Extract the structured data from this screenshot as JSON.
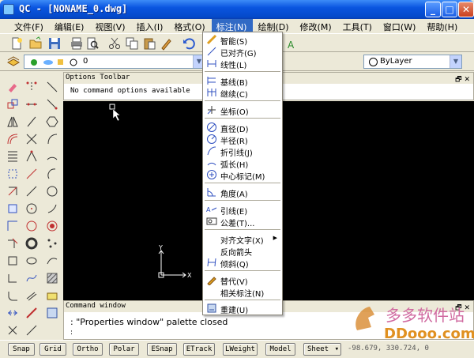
{
  "window": {
    "title": "QC - [NONAME_0.dwg]"
  },
  "menubar": {
    "items": [
      {
        "label": "文件(F)"
      },
      {
        "label": "编辑(E)"
      },
      {
        "label": "视图(V)"
      },
      {
        "label": "插入(I)"
      },
      {
        "label": "格式(O)"
      },
      {
        "label": "标注(N)"
      },
      {
        "label": "绘制(D)"
      },
      {
        "label": "修改(M)"
      },
      {
        "label": "工具(T)"
      },
      {
        "label": "窗口(W)"
      },
      {
        "label": "帮助(H)"
      }
    ]
  },
  "layer_toolbar": {
    "layer_value": "0",
    "color_value": "ByLayer"
  },
  "options_toolbar": {
    "title": "Options Toolbar",
    "message": "No command options available"
  },
  "command_window": {
    "title": "Command window",
    "last_line": ": \"Properties window\" palette closed",
    "prompt": ":"
  },
  "statusbar": {
    "buttons": [
      "Snap",
      "Grid",
      "Ortho",
      "Polar",
      "ESnap",
      "ETrack",
      "LWeight",
      "Model"
    ],
    "sheet": "Sheet",
    "coords": "-98.679, 330.724, 0"
  },
  "dimension_menu": {
    "items": [
      {
        "label": "智能(S)",
        "icon": "smart-dim-icon"
      },
      {
        "label": "已对齐(G)",
        "icon": "aligned-dim-icon"
      },
      {
        "label": "线性(L)",
        "icon": "linear-dim-icon"
      },
      {
        "label": "基线(B)",
        "icon": "baseline-dim-icon"
      },
      {
        "label": "继续(C)",
        "icon": "continue-dim-icon"
      },
      {
        "label": "坐标(O)",
        "icon": "ordinate-dim-icon"
      },
      {
        "label": "直径(D)",
        "icon": "diameter-dim-icon"
      },
      {
        "label": "半径(R)",
        "icon": "radius-dim-icon"
      },
      {
        "label": "折引线(J)",
        "icon": "jogged-dim-icon"
      },
      {
        "label": "弧长(H)",
        "icon": "arc-length-dim-icon"
      },
      {
        "label": "中心标记(M)",
        "icon": "center-mark-icon"
      },
      {
        "label": "角度(A)",
        "icon": "angular-dim-icon"
      },
      {
        "label": "引线(E)",
        "icon": "leader-icon"
      },
      {
        "label": "公差(T)...",
        "icon": "tolerance-icon"
      },
      {
        "label": "对齐文字(X)",
        "icon": ""
      },
      {
        "label": "反向箭头",
        "icon": ""
      },
      {
        "label": "倾斜(Q)",
        "icon": "oblique-icon"
      },
      {
        "label": "替代(V)",
        "icon": "override-icon"
      },
      {
        "label": "相关标注(N)",
        "icon": ""
      },
      {
        "label": "重建(U)",
        "icon": "regen-icon"
      }
    ]
  },
  "ucs": {
    "x_label": "X",
    "y_label": "Y"
  },
  "watermark": {
    "text": "多多软件站",
    "url": "DDooo.com"
  },
  "colors": {
    "menu_highlight": "#316ac5",
    "canvas": "#000000",
    "titlebar": "#0a55e0"
  }
}
